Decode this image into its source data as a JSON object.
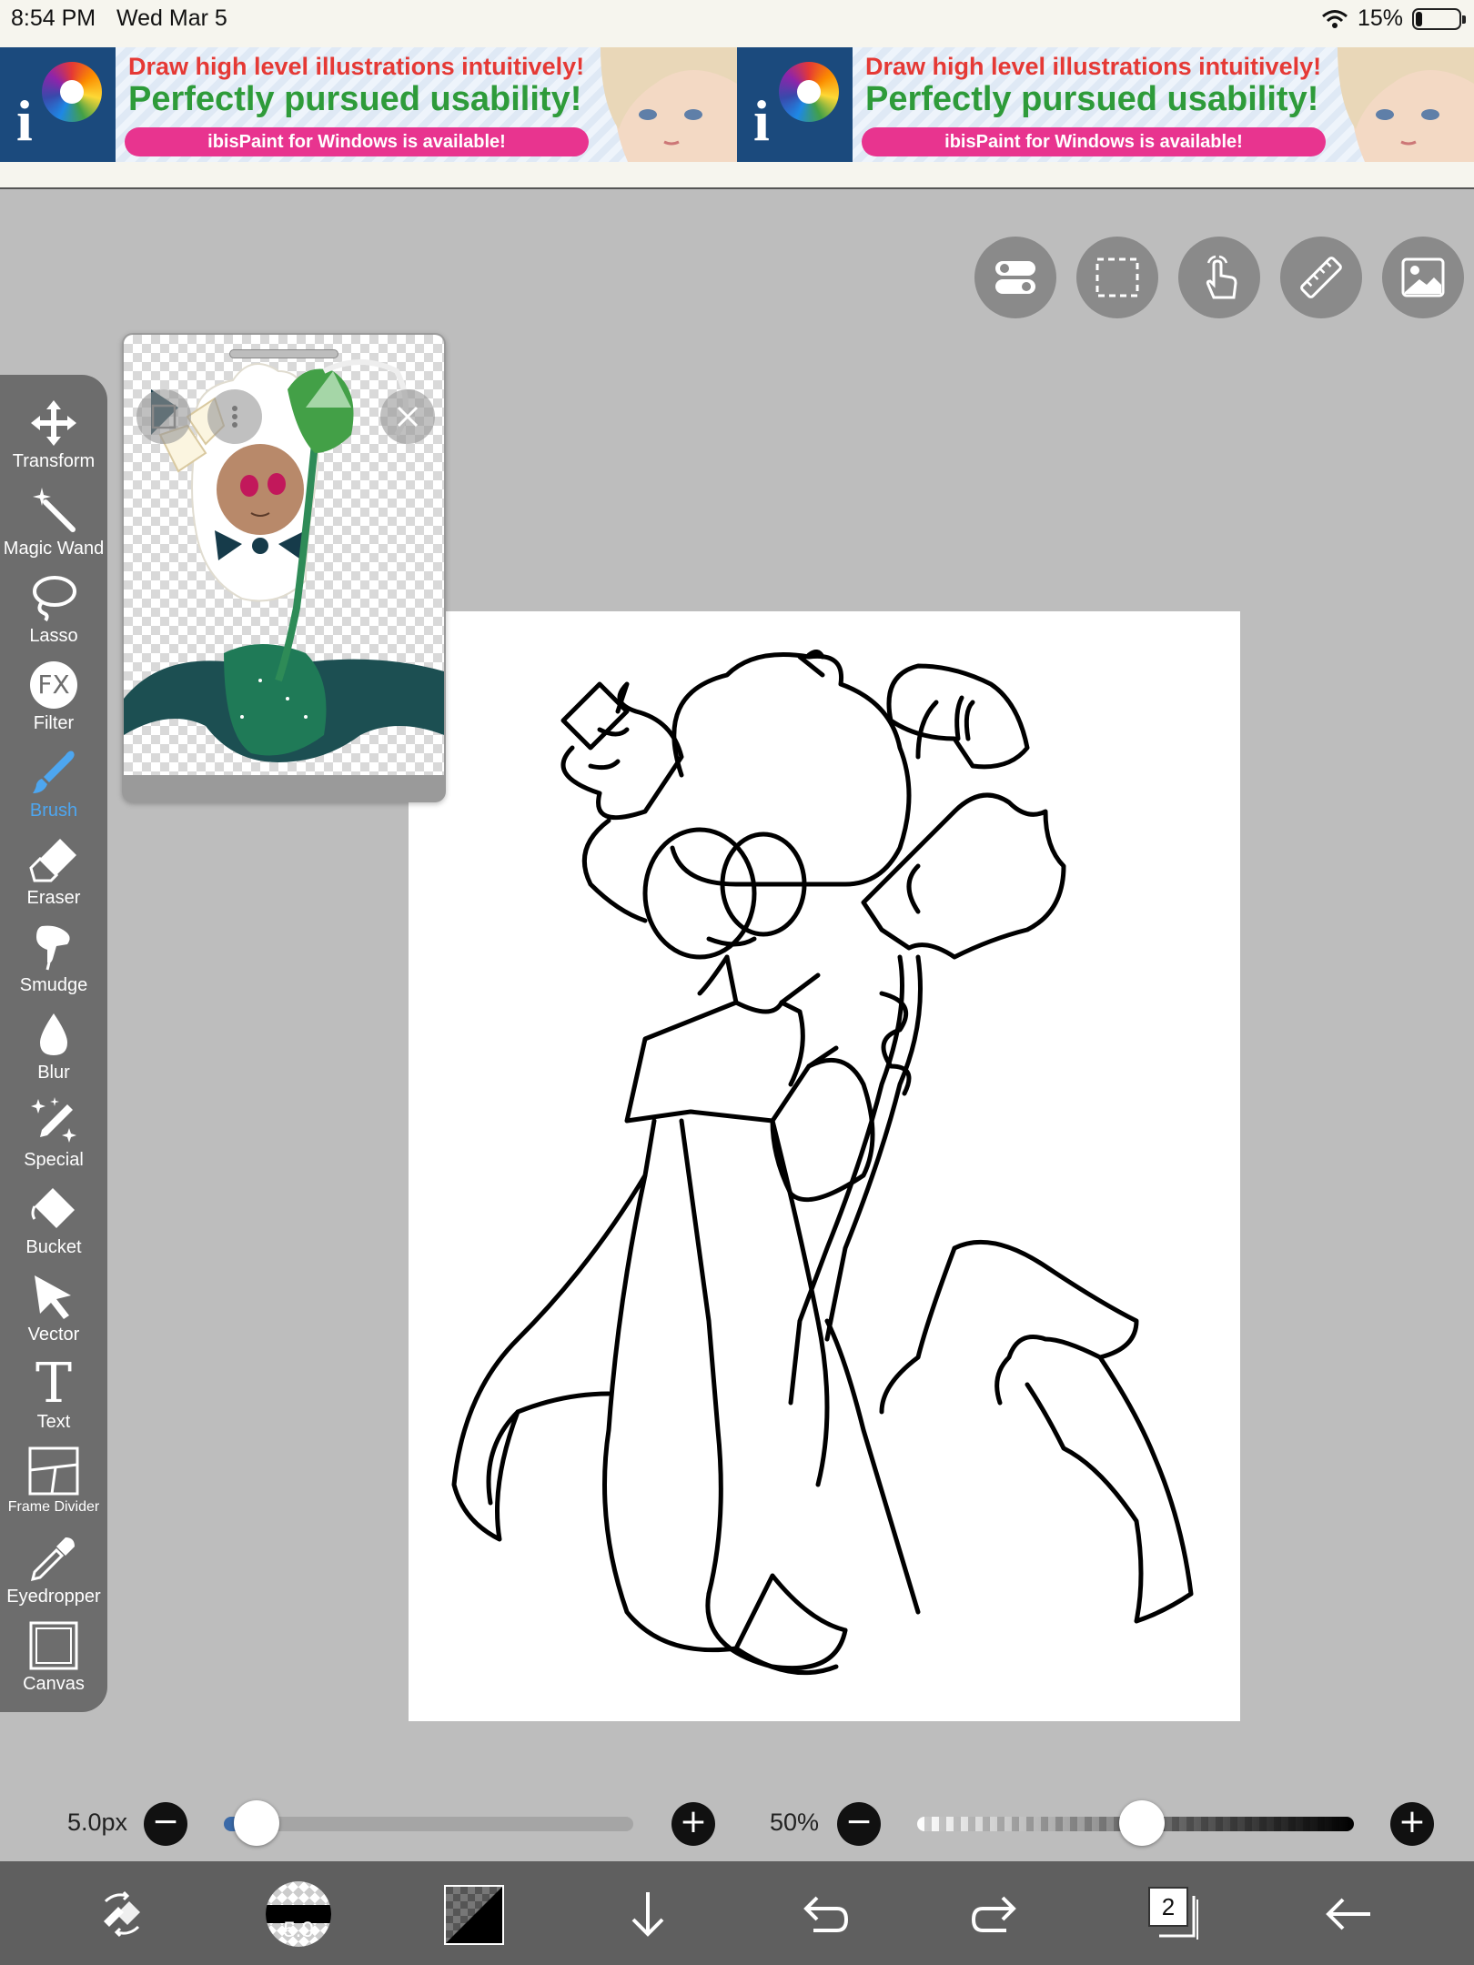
{
  "status": {
    "time": "8:54 PM",
    "date": "Wed Mar 5",
    "battery": "15%",
    "battery_level": 0.15
  },
  "ad": {
    "line1": "Draw high level illustrations intuitively!",
    "line2": "Perfectly pursued usability!",
    "line3": "ibisPaint for Windows is available!",
    "logo_letter": "i"
  },
  "top_tools": [
    "toggle-icon",
    "selection-rect-icon",
    "touch-gesture-icon",
    "ruler-icon",
    "image-icon"
  ],
  "tools": [
    {
      "label": "Transform",
      "icon": "move-arrows-icon"
    },
    {
      "label": "Magic Wand",
      "icon": "magic-wand-icon"
    },
    {
      "label": "Lasso",
      "icon": "lasso-icon"
    },
    {
      "label": "Filter",
      "icon": "fx-icon",
      "glyph": "FX"
    },
    {
      "label": "Brush",
      "icon": "brush-icon",
      "active": true
    },
    {
      "label": "Eraser",
      "icon": "eraser-icon"
    },
    {
      "label": "Smudge",
      "icon": "smudge-icon"
    },
    {
      "label": "Blur",
      "icon": "blur-drop-icon"
    },
    {
      "label": "Special",
      "icon": "special-sparkle-icon"
    },
    {
      "label": "Bucket",
      "icon": "bucket-icon"
    },
    {
      "label": "Vector",
      "icon": "vector-arrow-icon"
    },
    {
      "label": "Text",
      "icon": "text-icon",
      "glyph": "T"
    },
    {
      "label": "Frame Divider",
      "icon": "frame-divider-icon"
    },
    {
      "label": "Eyedropper",
      "icon": "eyedropper-icon"
    },
    {
      "label": "Canvas",
      "icon": "canvas-icon"
    }
  ],
  "brush": {
    "size_label": "5.0px",
    "size_fraction": 0.08,
    "preview_value": "5.0"
  },
  "opacity": {
    "label": "50%",
    "fraction": 0.5
  },
  "layers": {
    "count": "2"
  },
  "colors": {
    "accent": "#4da6f0",
    "toolbar": "#6d6d6d",
    "ad_pink": "#e8348f",
    "ad_green": "#2e9b3a",
    "ad_red": "#e53935"
  }
}
